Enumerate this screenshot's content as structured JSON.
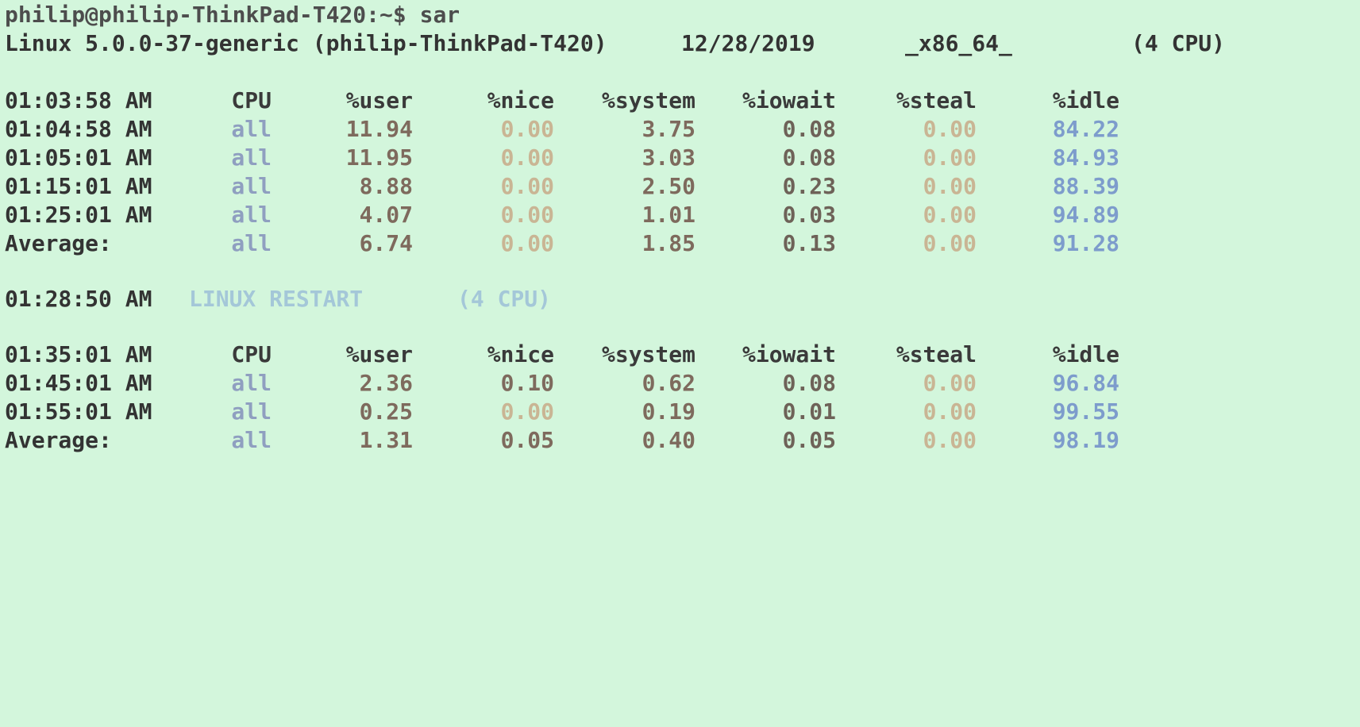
{
  "prompt": {
    "text": "philip@philip-ThinkPad-T420:~$ sar"
  },
  "sysinfo": {
    "kernel": "Linux 5.0.0-37-generic (philip-ThinkPad-T420)",
    "date": "12/28/2019",
    "arch": "_x86_64_",
    "cpus": "(4 CPU)"
  },
  "headers1": {
    "time": "01:03:58 AM",
    "cpu": "CPU",
    "user": "%user",
    "nice": "%nice",
    "system": "%system",
    "iowait": "%iowait",
    "steal": "%steal",
    "idle": "%idle"
  },
  "block1": [
    {
      "time": "01:04:58 AM",
      "cpu": "all",
      "user": "11.94",
      "nice": "0.00",
      "system": "3.75",
      "iowait": "0.08",
      "steal": "0.00",
      "idle": "84.22"
    },
    {
      "time": "01:05:01 AM",
      "cpu": "all",
      "user": "11.95",
      "nice": "0.00",
      "system": "3.03",
      "iowait": "0.08",
      "steal": "0.00",
      "idle": "84.93"
    },
    {
      "time": "01:15:01 AM",
      "cpu": "all",
      "user": "8.88",
      "nice": "0.00",
      "system": "2.50",
      "iowait": "0.23",
      "steal": "0.00",
      "idle": "88.39"
    },
    {
      "time": "01:25:01 AM",
      "cpu": "all",
      "user": "4.07",
      "nice": "0.00",
      "system": "1.01",
      "iowait": "0.03",
      "steal": "0.00",
      "idle": "94.89"
    },
    {
      "time": "Average:",
      "cpu": "all",
      "user": "6.74",
      "nice": "0.00",
      "system": "1.85",
      "iowait": "0.13",
      "steal": "0.00",
      "idle": "91.28"
    }
  ],
  "restart": {
    "time": "01:28:50 AM",
    "label": "LINUX RESTART",
    "cpus": "(4 CPU)"
  },
  "headers2": {
    "time": "01:35:01 AM",
    "cpu": "CPU",
    "user": "%user",
    "nice": "%nice",
    "system": "%system",
    "iowait": "%iowait",
    "steal": "%steal",
    "idle": "%idle"
  },
  "block2": [
    {
      "time": "01:45:01 AM",
      "cpu": "all",
      "user": "2.36",
      "nice": "0.10",
      "system": "0.62",
      "iowait": "0.08",
      "steal": "0.00",
      "idle": "96.84"
    },
    {
      "time": "01:55:01 AM",
      "cpu": "all",
      "user": "0.25",
      "nice": "0.00",
      "system": "0.19",
      "iowait": "0.01",
      "steal": "0.00",
      "idle": "99.55"
    },
    {
      "time": "Average:",
      "cpu": "all",
      "user": "1.31",
      "nice": "0.05",
      "system": "0.40",
      "iowait": "0.05",
      "steal": "0.00",
      "idle": "98.19"
    }
  ]
}
